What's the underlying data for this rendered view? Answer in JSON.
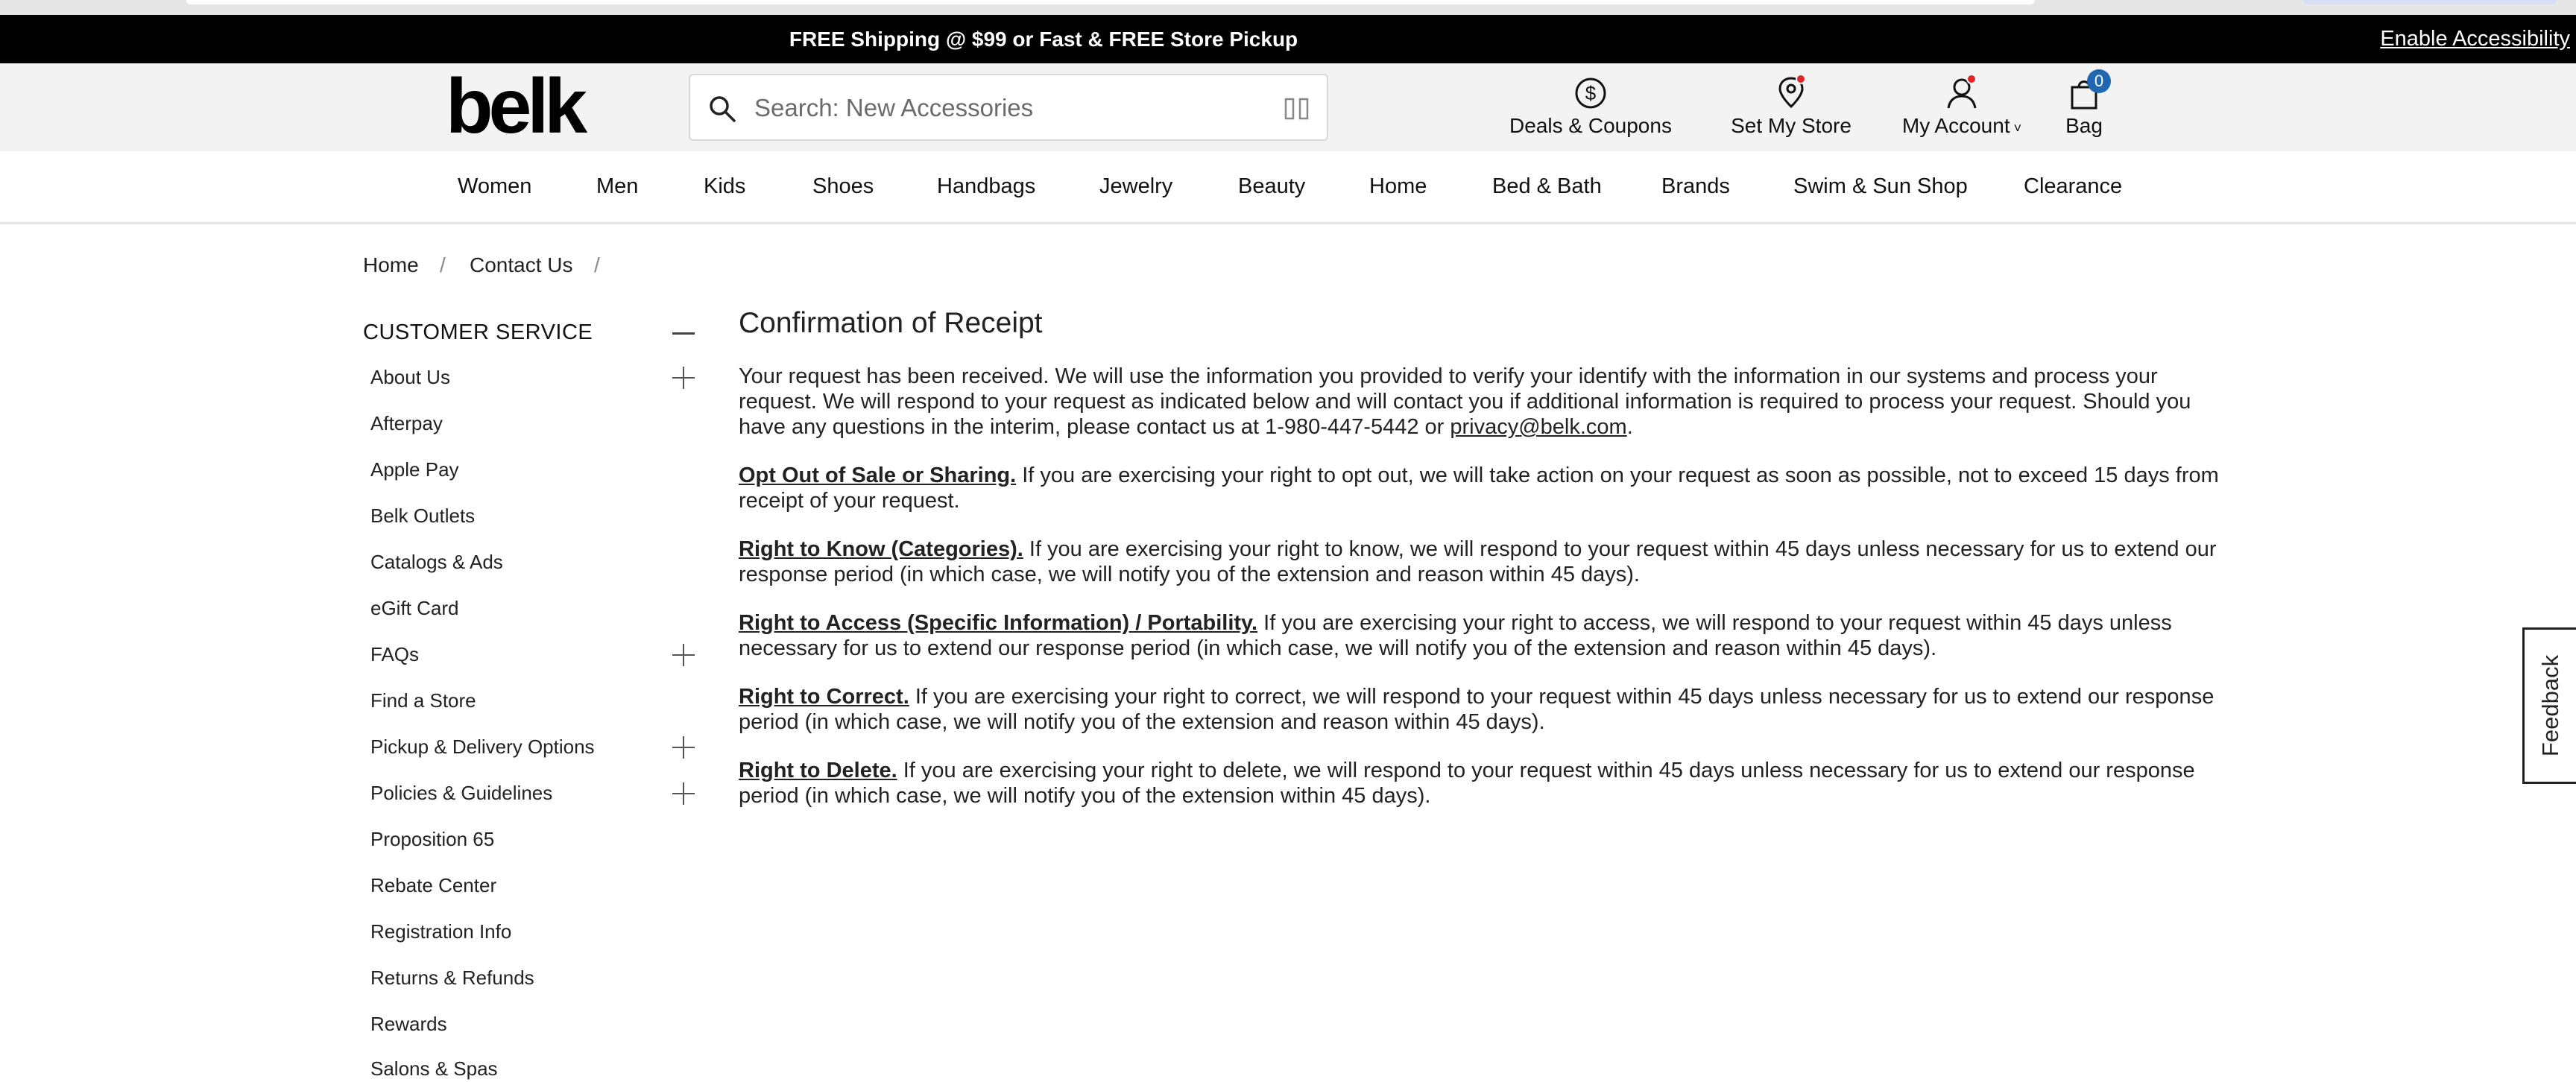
{
  "promo": {
    "text": "FREE Shipping @ $99  or Fast & FREE Store Pickup",
    "accessibility": "Enable Accessibility"
  },
  "header": {
    "logo": "belk",
    "search_placeholder": "Search: New Accessories",
    "deals_label": "Deals & Coupons",
    "store_label": "Set My Store",
    "account_label": "My Account",
    "bag_label": "Bag",
    "bag_count": "0"
  },
  "nav": {
    "items": [
      "Women",
      "Men",
      "Kids",
      "Shoes",
      "Handbags",
      "Jewelry",
      "Beauty",
      "Home",
      "Bed & Bath",
      "Brands",
      "Swim & Sun Shop",
      "Clearance"
    ]
  },
  "breadcrumb": {
    "home": "Home",
    "sep": "/",
    "contact": "Contact Us"
  },
  "sidebar": {
    "heading": "CUSTOMER SERVICE",
    "items": [
      {
        "label": "About Us",
        "expandable": true
      },
      {
        "label": "Afterpay",
        "expandable": false
      },
      {
        "label": "Apple Pay",
        "expandable": false
      },
      {
        "label": "Belk Outlets",
        "expandable": false
      },
      {
        "label": "Catalogs & Ads",
        "expandable": false
      },
      {
        "label": "eGift Card",
        "expandable": false
      },
      {
        "label": "FAQs",
        "expandable": true
      },
      {
        "label": "Find a Store",
        "expandable": false
      },
      {
        "label": "Pickup & Delivery Options",
        "expandable": true
      },
      {
        "label": "Policies & Guidelines",
        "expandable": true
      },
      {
        "label": "Proposition 65",
        "expandable": false
      },
      {
        "label": "Rebate Center",
        "expandable": false
      },
      {
        "label": "Registration Info",
        "expandable": false
      },
      {
        "label": "Returns & Refunds",
        "expandable": false
      },
      {
        "label": "Rewards",
        "expandable": false
      },
      {
        "label": "Salons & Spas",
        "expandable": false
      }
    ]
  },
  "main": {
    "title": "Confirmation of Receipt",
    "intro": "Your request has been received. We will use the information you provided to verify your identify with the information in our systems and process your request. We will respond to your request as indicated below and will contact you if additional information is required to process your request. Should you have any questions in the interim, please contact us at 1-980-447-5442 or ",
    "email": "privacy@belk.com",
    "intro_end": ".",
    "sections": [
      {
        "label": "Opt Out of Sale or Sharing.",
        "text": " If you are exercising your right to opt out, we will take action on your request as soon as possible, not to exceed 15 days from receipt of your request."
      },
      {
        "label": "Right to Know (Categories).",
        "text": " If you are exercising your right to know, we will respond to your request within 45 days unless necessary for us to extend our response period (in which case, we will notify you of the extension and reason within 45 days)."
      },
      {
        "label": "Right to Access (Specific Information) / Portability.",
        "text": " If you are exercising your right to access, we will respond to your request within 45 days unless necessary for us to extend our response period (in which case, we will notify you of the extension and reason within 45 days)."
      },
      {
        "label": "Right to Correct.",
        "text": " If you are exercising your right to correct, we will respond to your request within 45 days unless necessary for us to extend our response period (in which case, we will notify you of the extension and reason within 45 days)."
      },
      {
        "label": "Right to Delete.",
        "text": " If you are exercising your right to delete, we will respond to your request within 45 days unless necessary for us to extend our response period (in which case, we will notify you of the extension within 45 days)."
      }
    ]
  },
  "feedback": "Feedback",
  "colors": {
    "promo_bg": "#000000",
    "header_bg": "#f3f3f3",
    "badge_blue": "#1f67b1",
    "dot_red": "#e0262b"
  }
}
